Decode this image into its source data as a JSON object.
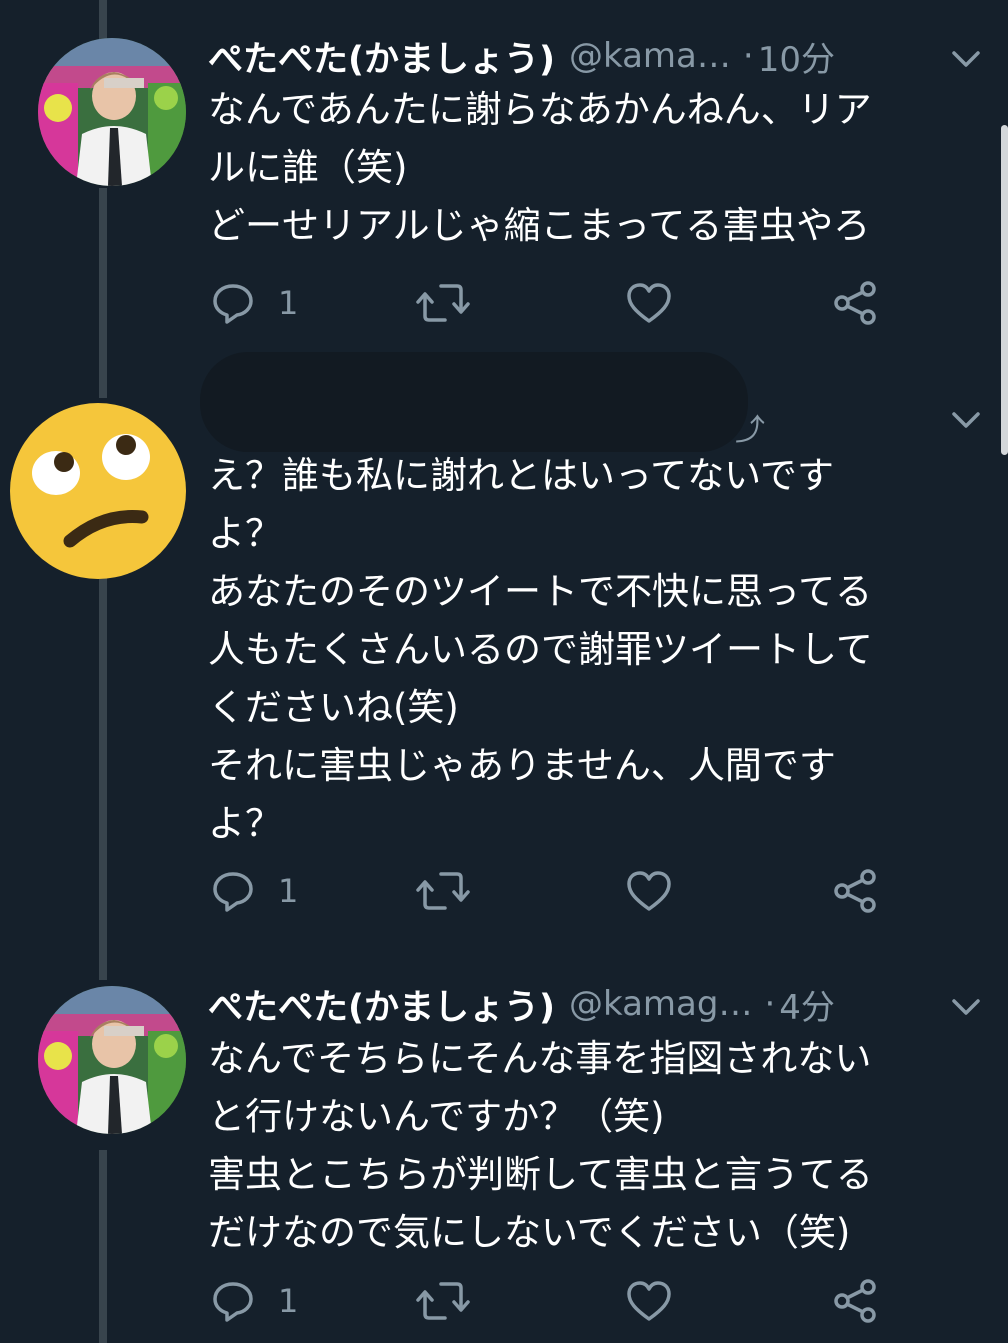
{
  "tweets": [
    {
      "name": "ぺたぺた(かましょう)",
      "handle": "@kama…",
      "separator": "·",
      "time": "10分",
      "lines": [
        "なんであんたに謝らなあかんねん、リア",
        "ルに誰（笑)",
        "どーせリアルじゃ縮こまってる害虫やろ"
      ],
      "reply_count": "1",
      "avatar_icon": "profile-photo"
    },
    {
      "lines": [
        "え？誰も私に謝れとはいってないです",
        "よ？",
        "あなたのそのツイートで不快に思ってる",
        "人もたくさんいるので謝罪ツイートして",
        "くださいね(笑)",
        "それに害虫じゃありません、人間です",
        "よ？"
      ],
      "reply_count": "1",
      "avatar_icon": "face-with-rolling-eyes-emoji"
    },
    {
      "name": "ぺたぺた(かましょう)",
      "handle": "@kamag…",
      "separator": "·",
      "time": "4分",
      "lines": [
        "なんでそちらにそんな事を指図されない",
        "と行けないんですか？（笑)",
        "害虫とこちらが判断して害虫と言うてる",
        "だけなので気にしないでください（笑)"
      ],
      "reply_count": "1",
      "avatar_icon": "profile-photo"
    }
  ],
  "icons": [
    "reply-icon",
    "retweet-icon",
    "like-icon",
    "share-icon",
    "chevron-down-icon"
  ],
  "colors": {
    "background": "#15202b",
    "text": "#ffffff",
    "muted": "#8899a6",
    "thread_line": "#38444d",
    "emoji_yellow": "#f5c63b"
  }
}
